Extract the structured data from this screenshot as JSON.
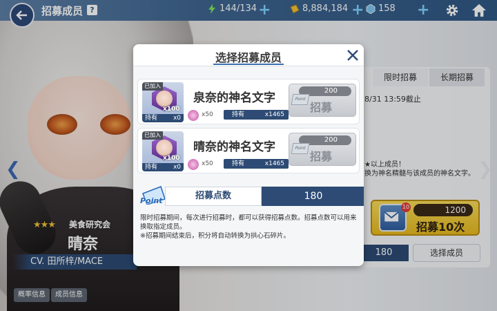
{
  "topbar": {
    "title": "招募成员",
    "help": "?",
    "stamina": "144/134",
    "gold": "8,884,184",
    "gems": "158"
  },
  "character": {
    "stars": "★★★",
    "club": "美食研究会",
    "name": "晴奈",
    "cv": "CV. 田所梓/MACE"
  },
  "bottom_buttons": {
    "probability": "概率信息",
    "members": "成员信息"
  },
  "right_panel": {
    "tab_limited": "限时招募",
    "tab_long": "长期招募",
    "deadline": "8/31  13:59截止",
    "desc1": "★以上成员！",
    "desc2": "换为神名精髓与该成员的神名文字。",
    "recruit10_badge": "10",
    "recruit10_cost": "1200",
    "recruit10_label": "招募10次",
    "points_value": "180",
    "select_member": "选择成员"
  },
  "modal": {
    "title": "选择招募成员",
    "cards": [
      {
        "joined": "已加入",
        "count": "x100",
        "own_label": "持有",
        "own_value": "x0",
        "frag_count": "x50",
        "frag_own_label": "持有",
        "frag_own_value": "x1465",
        "name": "泉奈的神名文字",
        "cost": "200",
        "point_text": "Point",
        "recruit_label": "招募"
      },
      {
        "joined": "已加入",
        "count": "x100",
        "own_label": "持有",
        "own_value": "x0",
        "frag_count": "x50",
        "frag_own_label": "持有",
        "frag_own_value": "x1465",
        "name": "晴奈的神名文字",
        "cost": "200",
        "point_text": "Point",
        "recruit_label": "招募"
      }
    ],
    "points_logo": "Point",
    "points_label": "招募点数",
    "points_value": "180",
    "info": [
      "限时招募期间，每次进行招募时，都可以获得招募点数。招募点数可以用来",
      "换取指定成员。",
      "※招募期间结束后，积分将自动转换为拱心石碎片。"
    ]
  },
  "colors": {
    "navy": "#2d4b74",
    "accent_blue": "#3a6fb0",
    "gold_button": "#e7b91f"
  }
}
